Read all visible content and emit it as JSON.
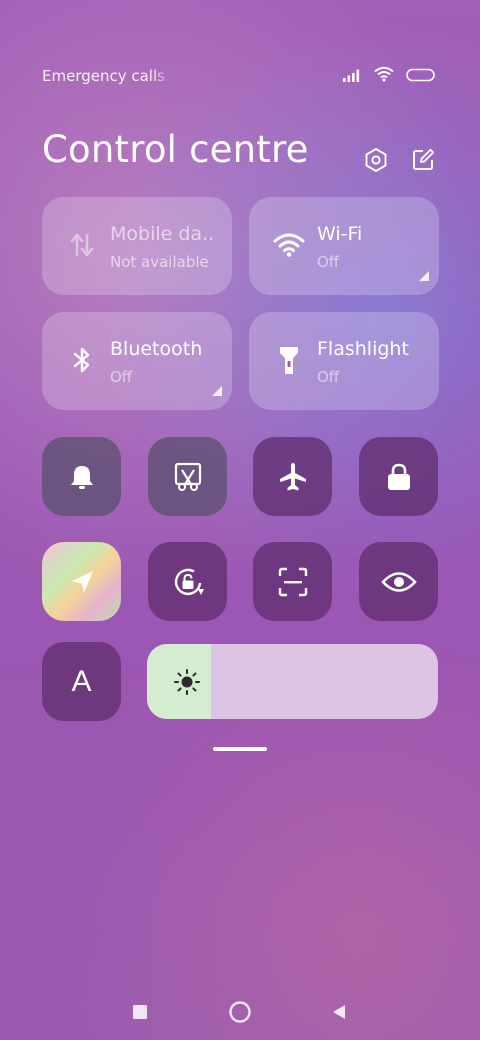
{
  "status_bar": {
    "left_text": "Emergency calls only",
    "icons": [
      "signal-icon",
      "wifi-icon",
      "battery-icon"
    ]
  },
  "header": {
    "title": "Control centre",
    "icons": [
      "settings-icon",
      "edit-icon"
    ]
  },
  "tiles": [
    {
      "name": "Mobile da..",
      "status": "Not available",
      "icon": "mobile-data-icon"
    },
    {
      "name": "Wi-Fi",
      "status": "Off",
      "icon": "wifi-icon"
    },
    {
      "name": "Bluetooth",
      "status": "Off",
      "icon": "bluetooth-icon"
    },
    {
      "name": "Flashlight",
      "status": "Off",
      "icon": "flashlight-icon"
    }
  ],
  "toggles_row1": [
    "bell-icon",
    "screenshot-icon",
    "airplane-icon",
    "lock-icon"
  ],
  "toggles_row2": [
    "location-icon",
    "rotation-lock-icon",
    "scanner-icon",
    "eye-icon"
  ],
  "font_toggle_label": "A",
  "brightness": {
    "level": 0.22,
    "icon": "sun-icon"
  },
  "navigation": [
    "recents-icon",
    "home-icon",
    "back-icon"
  ],
  "colors": {
    "tile_bg": "rgba(255,255,255,0.22)",
    "toggle_bg": "#5f2d6e",
    "brightness_track": "#e1cde8",
    "brightness_fill": "#d4ecd0"
  }
}
